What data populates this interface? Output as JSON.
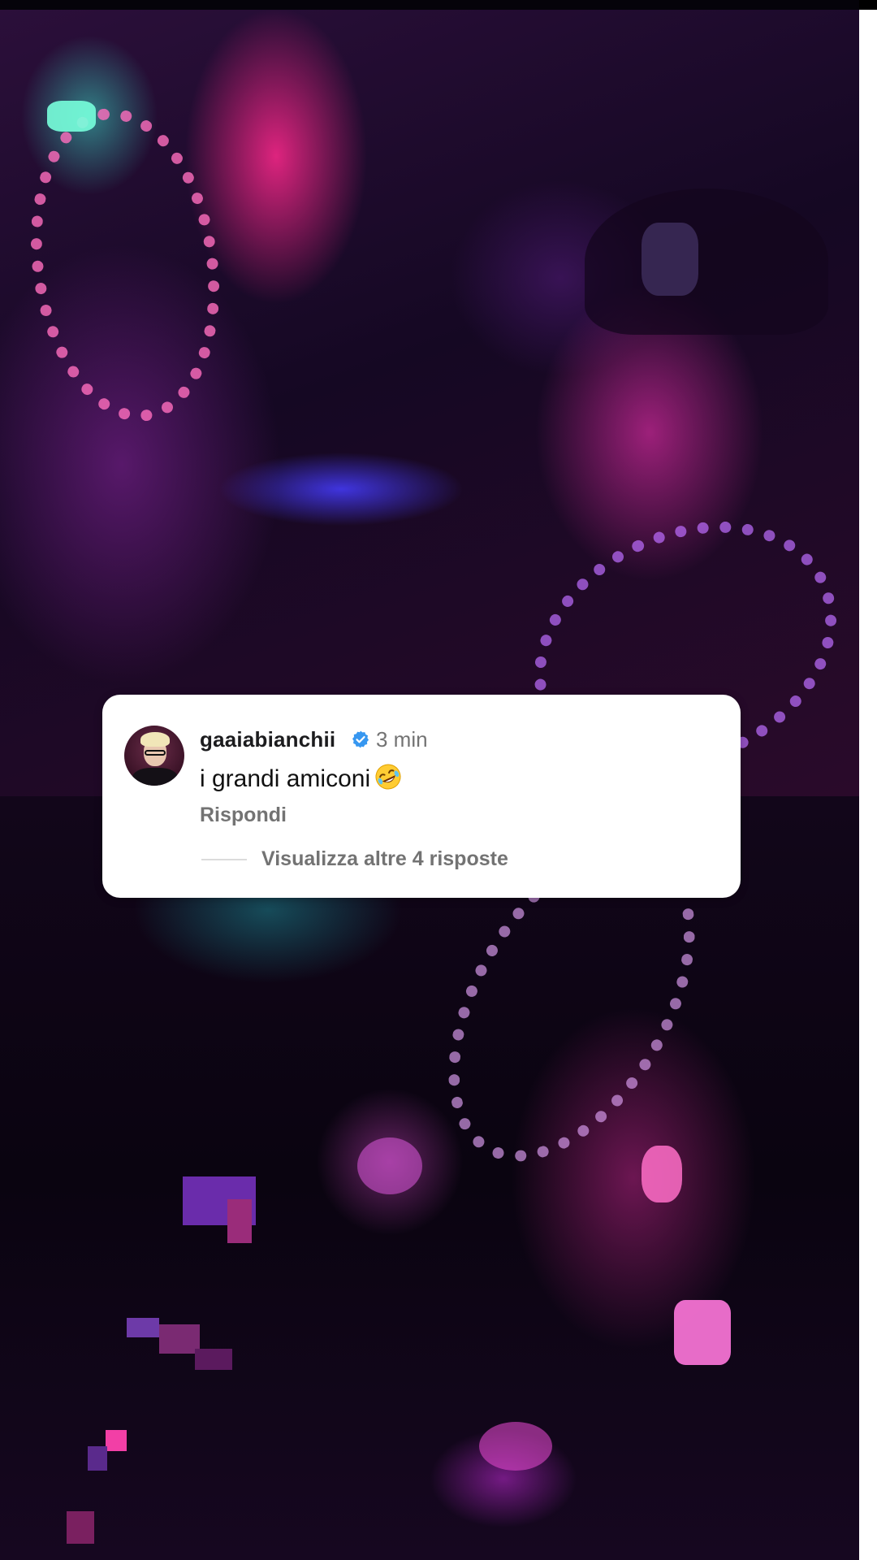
{
  "comment": {
    "username": "gaaiabianchii",
    "verified_icon": "verified-badge-icon",
    "time": "3 min",
    "text": "i grandi amiconi",
    "emoji": "rolling-on-the-floor-laughing-emoji",
    "reply_label": "Rispondi",
    "view_replies_label": "Visualizza altre 4 risposte"
  },
  "colors": {
    "verified": "#3797f0",
    "secondary_text": "#737373",
    "card_background": "#ffffff"
  }
}
